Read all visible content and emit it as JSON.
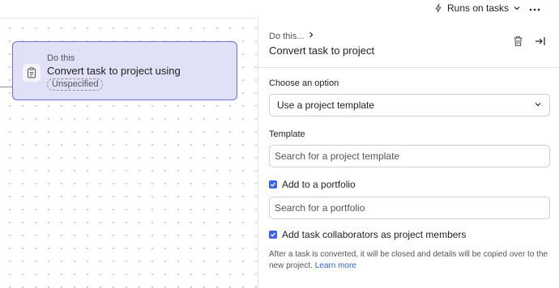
{
  "topbar": {
    "runs_on_label": "Runs on tasks",
    "icons": {
      "runs_on": "lightning-icon",
      "dropdown": "chevron-down-icon",
      "more": "more-horizontal-icon"
    }
  },
  "canvas": {
    "card": {
      "kicker": "Do this",
      "title": "Convert task to project using",
      "badge": "Unspecified",
      "icon": "clipboard-icon"
    }
  },
  "panel": {
    "breadcrumb": "Do this...",
    "title": "Convert task to project",
    "icons": {
      "breadcrumb_chevron": "chevron-right-icon",
      "delete": "trash-icon",
      "close": "collapse-panel-icon"
    },
    "choose_option": {
      "label": "Choose an option",
      "value": "Use a project template"
    },
    "template": {
      "label": "Template",
      "placeholder": "Search for a project template"
    },
    "add_to_portfolio": {
      "label": "Add to a portfolio",
      "checked": true,
      "placeholder": "Search for a portfolio"
    },
    "add_collaborators": {
      "label": "Add task collaborators as project members",
      "checked": true
    },
    "help_text": "After a task is converted, it will be closed and details will be copied over to the new project.",
    "learn_more": "Learn more"
  },
  "colors": {
    "accent": "#3e63dd",
    "card_fill": "#e0e1f7",
    "card_border": "#6d6fd6",
    "link": "#3064cc"
  }
}
